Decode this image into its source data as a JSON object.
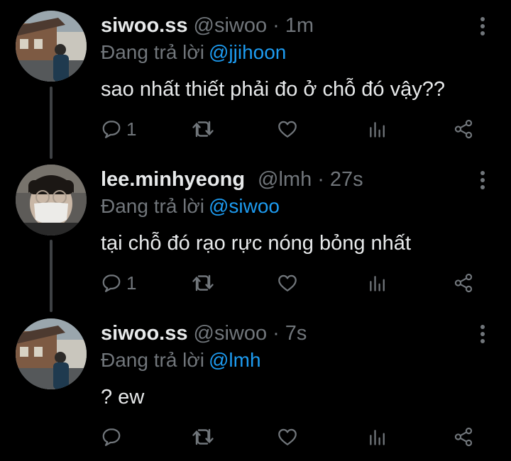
{
  "colors": {
    "background": "#000000",
    "text": "#e7e9ea",
    "muted": "#71767b",
    "mention": "#1d9bf0",
    "thread_line": "#3e4144"
  },
  "icons": {
    "reply": "reply-bubble-icon",
    "retweet": "retweet-icon",
    "like": "heart-icon",
    "views": "views-bar-chart-icon",
    "share": "share-icon",
    "more": "more-vertical-icon"
  },
  "tweets": [
    {
      "display_name": "siwoo.ss",
      "handle": "@siwoo",
      "separator": "·",
      "time": "1m",
      "reply_prefix": "Đang trả lời",
      "reply_to": "@jjihoon",
      "text": "sao nhất thiết phải đo ở chỗ đó vậy??",
      "reply_count": "1"
    },
    {
      "display_name": "lee.minhyeong",
      "handle": "@lmh",
      "separator": "·",
      "time": "27s",
      "reply_prefix": "Đang trả lời",
      "reply_to": "@siwoo",
      "text": "tại chỗ đó rạo rực nóng bỏng nhất",
      "reply_count": "1"
    },
    {
      "display_name": "siwoo.ss",
      "handle": "@siwoo",
      "separator": "·",
      "time": "7s",
      "reply_prefix": "Đang trả lời",
      "reply_to": "@lmh",
      "text": "? ew",
      "reply_count": ""
    }
  ]
}
